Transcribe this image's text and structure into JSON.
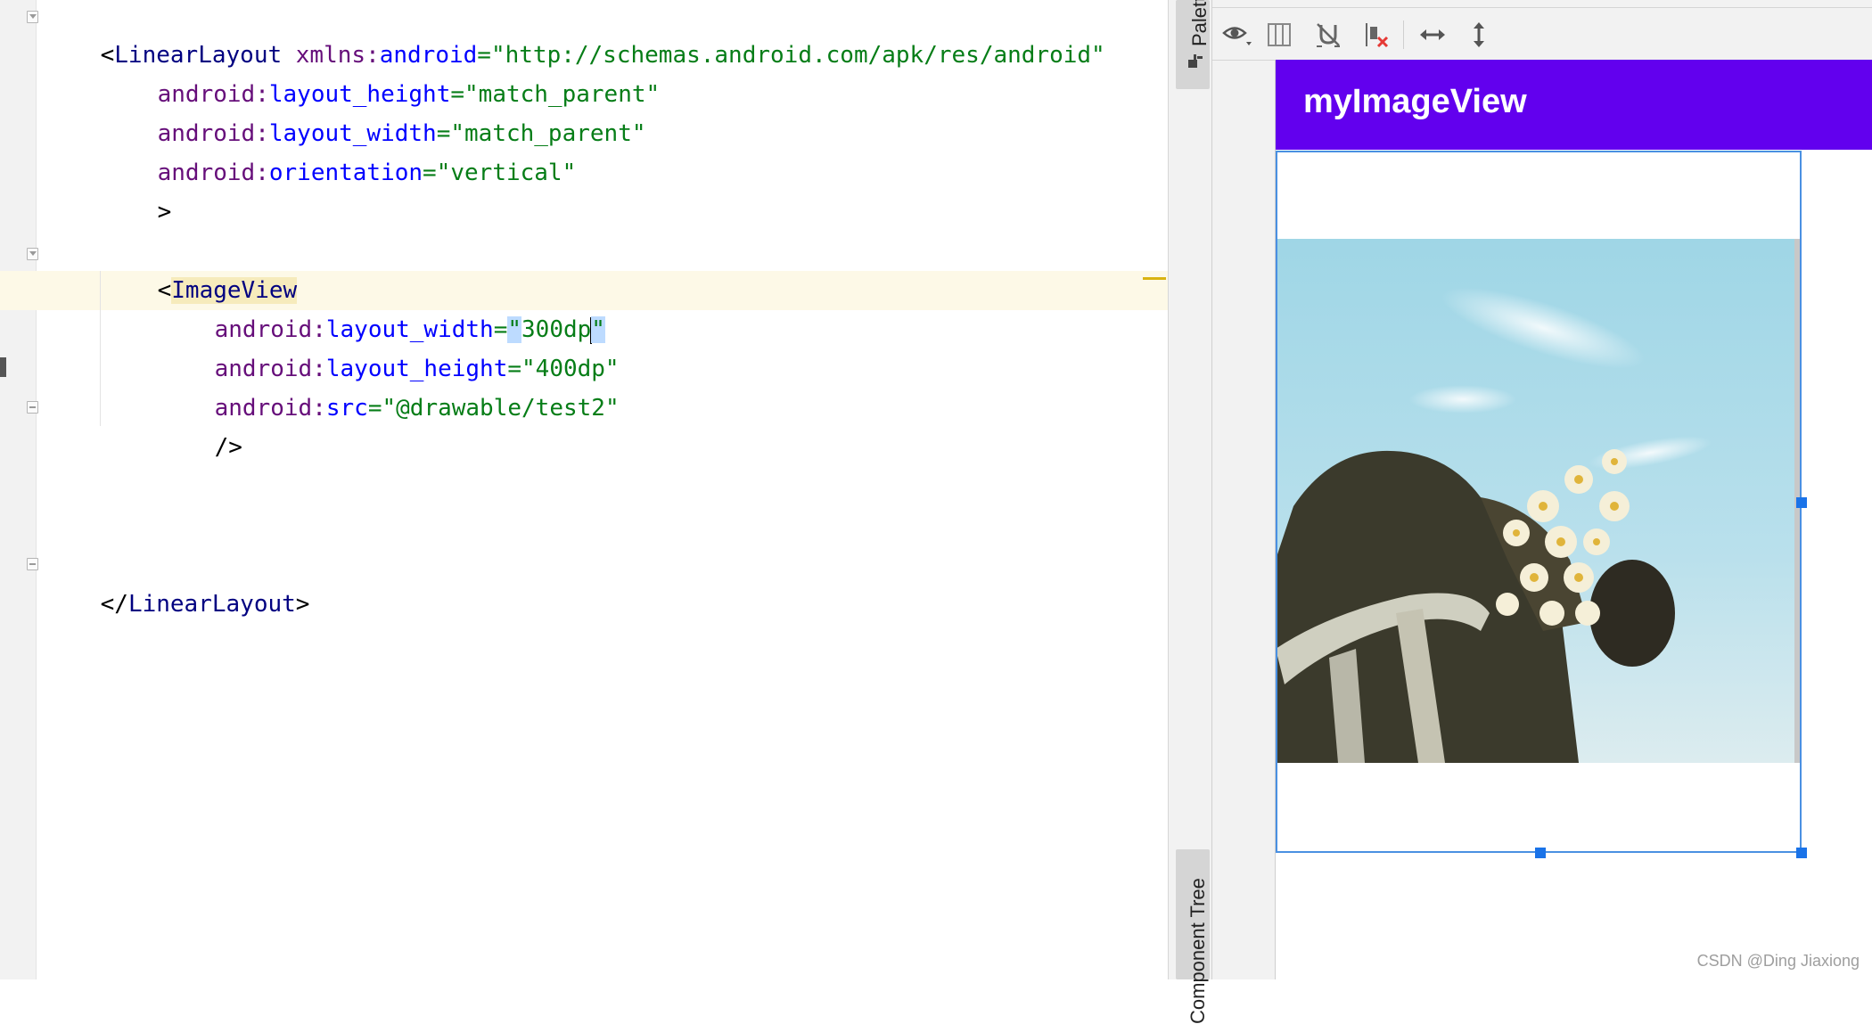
{
  "editor": {
    "lines": [
      {
        "parts": [
          "<",
          "LinearLayout",
          " ",
          "xmlns",
          ":",
          "android",
          "=",
          "\"http://schemas.android.com/apk/res/android\""
        ]
      },
      {
        "parts": [
          "android",
          ":",
          "layout_height",
          "=",
          "\"match_parent\""
        ]
      },
      {
        "parts": [
          "android",
          ":",
          "layout_width",
          "=",
          "\"match_parent\""
        ]
      },
      {
        "parts": [
          "android",
          ":",
          "orientation",
          "=",
          "\"vertical\""
        ]
      },
      {
        "parts": [
          ">"
        ]
      },
      {
        "parts": [
          "<",
          "ImageView"
        ]
      },
      {
        "parts": [
          "android",
          ":",
          "layout_width",
          "=",
          "\"",
          "300dp",
          "\""
        ]
      },
      {
        "parts": [
          "android",
          ":",
          "layout_height",
          "=",
          "\"400dp\""
        ]
      },
      {
        "parts": [
          "android",
          ":",
          "src",
          "=",
          "\"@drawable/test2\""
        ]
      },
      {
        "parts": [
          "/>"
        ]
      },
      {
        "parts": [
          "</",
          "LinearLayout",
          ">"
        ]
      }
    ]
  },
  "side_panels": {
    "palette_label": "Palette",
    "component_tree_label": "Component Tree"
  },
  "toolbar": {
    "icons": [
      "eye-icon",
      "blueprint-columns-icon",
      "magnet-off-icon",
      "clear-constraints-icon",
      "expand-horizontal-icon",
      "expand-vertical-icon"
    ]
  },
  "preview": {
    "app_title": "myImageView",
    "app_bar_color": "#6200ee",
    "image_description_icon": "photo-icon"
  },
  "watermark": "CSDN @Ding Jiaxiong"
}
